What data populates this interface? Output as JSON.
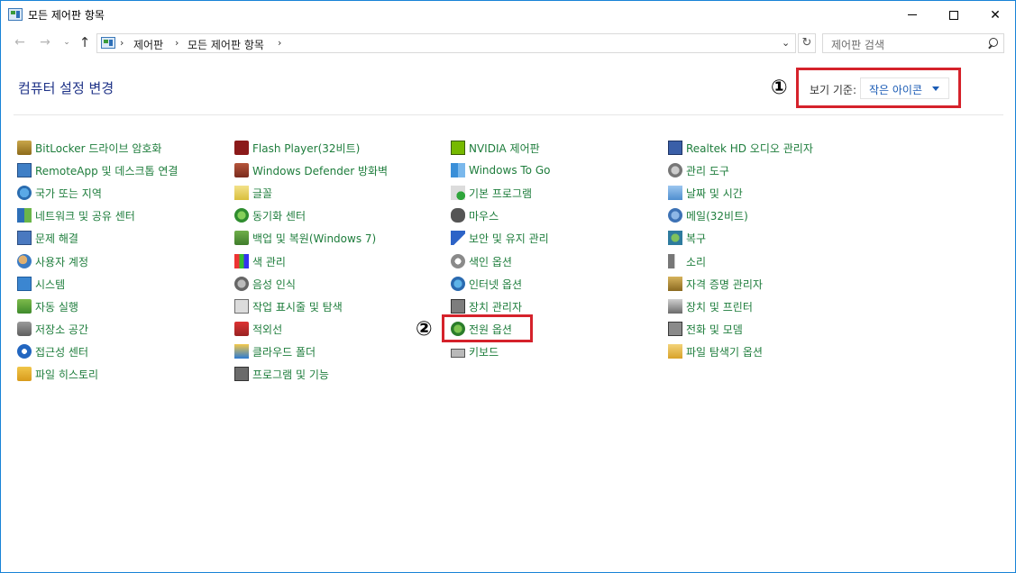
{
  "window": {
    "title": "모든 제어판 항목",
    "minimize_symbol": "",
    "close_symbol": "✕"
  },
  "nav": {
    "back": "←",
    "forward": "→",
    "dropdown": "⌄",
    "up": "↑",
    "breadcrumbs": [
      "제어판",
      "모든 제어판 항목"
    ],
    "separator": "›",
    "address_dropdown": "⌄",
    "refresh": "↻"
  },
  "search": {
    "placeholder": "제어판 검색"
  },
  "header": {
    "title": "컴퓨터 설정 변경",
    "view_by_label": "보기 기준:",
    "view_by_value": "작은 아이콘",
    "annotation_1": "①",
    "annotation_2": "②"
  },
  "columns": [
    {
      "items": [
        {
          "label": "BitLocker 드라이브 암호화",
          "icon": "bitlocker-icon"
        },
        {
          "label": "RemoteApp 및 데스크톱 연결",
          "icon": "remoteapp-icon"
        },
        {
          "label": "국가 또는 지역",
          "icon": "region-icon"
        },
        {
          "label": "네트워크 및 공유 센터",
          "icon": "network-icon"
        },
        {
          "label": "문제 해결",
          "icon": "troubleshoot-icon"
        },
        {
          "label": "사용자 계정",
          "icon": "user-accounts-icon"
        },
        {
          "label": "시스템",
          "icon": "system-icon"
        },
        {
          "label": "자동 실행",
          "icon": "autoplay-icon"
        },
        {
          "label": "저장소 공간",
          "icon": "storage-icon"
        },
        {
          "label": "접근성 센터",
          "icon": "accessibility-icon"
        },
        {
          "label": "파일 히스토리",
          "icon": "file-history-icon"
        }
      ]
    },
    {
      "items": [
        {
          "label": "Flash Player(32비트)",
          "icon": "flash-icon"
        },
        {
          "label": "Windows Defender 방화벽",
          "icon": "firewall-icon"
        },
        {
          "label": "글꼴",
          "icon": "fonts-icon"
        },
        {
          "label": "동기화 센터",
          "icon": "sync-icon"
        },
        {
          "label": "백업 및 복원(Windows 7)",
          "icon": "backup-icon"
        },
        {
          "label": "색 관리",
          "icon": "color-management-icon"
        },
        {
          "label": "음성 인식",
          "icon": "speech-icon"
        },
        {
          "label": "작업 표시줄 및 탐색",
          "icon": "taskbar-icon"
        },
        {
          "label": "적외선",
          "icon": "infrared-icon"
        },
        {
          "label": "클라우드 폴더",
          "icon": "cloud-folder-icon"
        },
        {
          "label": "프로그램 및 기능",
          "icon": "programs-icon"
        }
      ]
    },
    {
      "items": [
        {
          "label": "NVIDIA 제어판",
          "icon": "nvidia-icon"
        },
        {
          "label": "Windows To Go",
          "icon": "windows-to-go-icon"
        },
        {
          "label": "기본 프로그램",
          "icon": "default-programs-icon"
        },
        {
          "label": "마우스",
          "icon": "mouse-icon"
        },
        {
          "label": "보안 및 유지 관리",
          "icon": "flag-icon"
        },
        {
          "label": "색인 옵션",
          "icon": "indexing-icon"
        },
        {
          "label": "인터넷 옵션",
          "icon": "internet-options-icon"
        },
        {
          "label": "장치 관리자",
          "icon": "device-manager-icon"
        },
        {
          "label": "전원 옵션",
          "icon": "power-icon"
        },
        {
          "label": "키보드",
          "icon": "keyboard-icon"
        }
      ]
    },
    {
      "items": [
        {
          "label": "Realtek HD 오디오 관리자",
          "icon": "audio-manager-icon"
        },
        {
          "label": "관리 도구",
          "icon": "admin-tools-icon"
        },
        {
          "label": "날짜 및 시간",
          "icon": "date-time-icon"
        },
        {
          "label": "메일(32비트)",
          "icon": "mail-icon"
        },
        {
          "label": "복구",
          "icon": "recovery-icon"
        },
        {
          "label": "소리",
          "icon": "sound-icon"
        },
        {
          "label": "자격 증명 관리자",
          "icon": "credential-icon"
        },
        {
          "label": "장치 및 프린터",
          "icon": "printer-icon"
        },
        {
          "label": "전화 및 모뎀",
          "icon": "phone-modem-icon"
        },
        {
          "label": "파일 탐색기 옵션",
          "icon": "folder-options-icon"
        }
      ]
    }
  ],
  "colors": {
    "link_green": "#1e7d3c",
    "title_blue": "#1e3287",
    "annotation_red": "#d5222b"
  }
}
